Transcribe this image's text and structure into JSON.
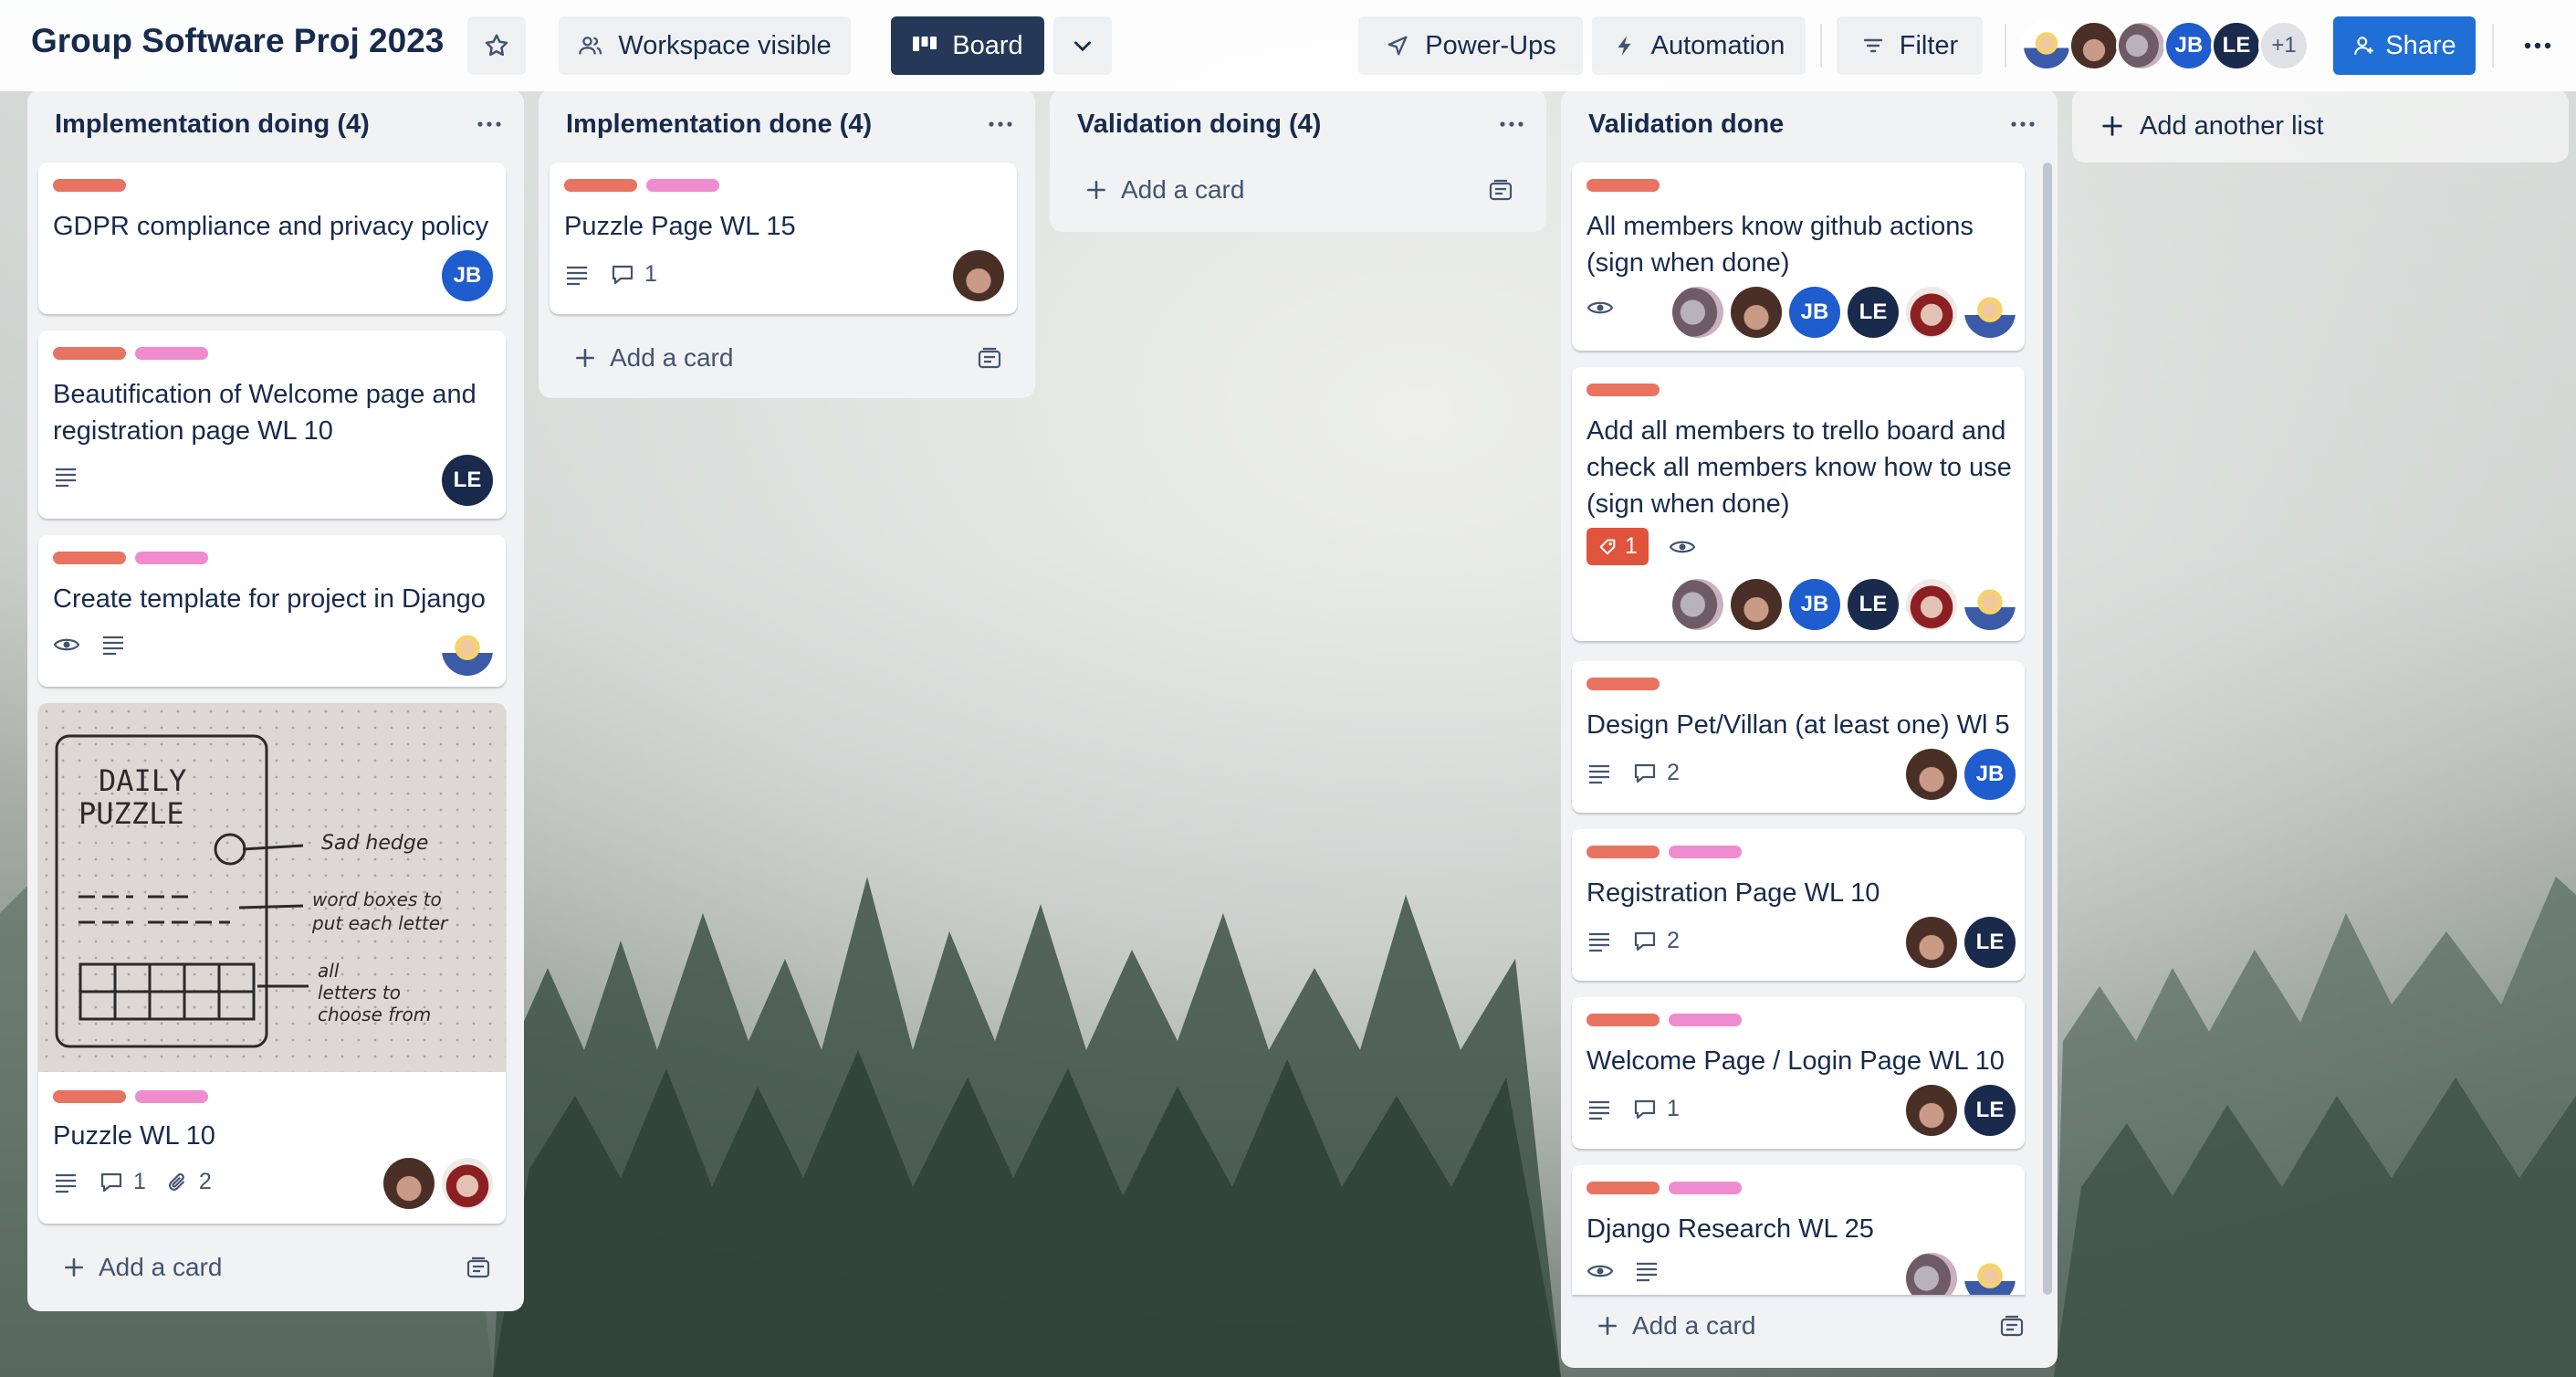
{
  "header": {
    "board_title": "Group Software Proj 2023",
    "visibility_label": "Workspace visible",
    "view_label": "Board",
    "powerups_label": "Power-Ups",
    "automation_label": "Automation",
    "filter_label": "Filter",
    "members_extra": "+1",
    "member_initials": [
      "JB",
      "LE"
    ],
    "share_label": "Share"
  },
  "lists": [
    {
      "title": "Implementation doing (4)",
      "add_card": "Add a card",
      "cards": [
        {
          "title": "GDPR compliance and privacy policy",
          "labels": [
            "red"
          ],
          "members": [
            "JB"
          ]
        },
        {
          "title": "Beautification of Welcome page and registration page WL 10",
          "labels": [
            "red",
            "pink"
          ],
          "members": [
            "LE"
          ]
        },
        {
          "title": "Create template for project in Django",
          "labels": [
            "red",
            "pink"
          ],
          "members": []
        },
        {
          "title": "Puzzle WL 10",
          "labels": [
            "red",
            "pink"
          ],
          "comments": "1",
          "attachments": "2",
          "members": []
        }
      ]
    },
    {
      "title": "Implementation done (4)",
      "add_card": "Add a card",
      "cards": [
        {
          "title": "Puzzle Page WL 15",
          "labels": [
            "red",
            "pink"
          ],
          "comments": "1",
          "members": []
        }
      ]
    },
    {
      "title": "Validation doing (4)",
      "add_card": "Add a card",
      "cards": []
    },
    {
      "title": "Validation done",
      "add_card": "Add a card",
      "cards": [
        {
          "title": "All members know github actions (sign when done)",
          "labels": [
            "red"
          ],
          "members": [
            "JB",
            "LE"
          ]
        },
        {
          "title": "Add all members to trello board and check all members know how to use (sign when done)",
          "labels": [
            "red"
          ],
          "flag_count": "1",
          "members": [
            "JB",
            "LE"
          ]
        },
        {
          "title": "Design Pet/Villan (at least one) Wl 5",
          "labels": [
            "red"
          ],
          "comments": "2",
          "members": [
            "JB"
          ]
        },
        {
          "title": "Registration Page WL 10",
          "labels": [
            "red",
            "pink"
          ],
          "comments": "2",
          "members": [
            "LE"
          ]
        },
        {
          "title": "Welcome Page / Login Page WL 10",
          "labels": [
            "red",
            "pink"
          ],
          "comments": "1",
          "members": [
            "LE"
          ]
        },
        {
          "title": "Django Research WL 25",
          "labels": [
            "red",
            "pink"
          ],
          "members": []
        }
      ]
    }
  ],
  "add_list_label": "Add another list",
  "colors": {
    "label_red": "#e87361",
    "label_pink": "#ef8bcf",
    "share_blue": "#1f6fd6",
    "board_btn": "#253858"
  },
  "icons": [
    "star-icon",
    "workspace-icon",
    "board-icon",
    "chevron-down-icon",
    "rocket-icon",
    "lightning-icon",
    "filter-icon",
    "share-person-icon",
    "more-icon",
    "description-icon",
    "comment-icon",
    "watch-icon",
    "attachment-icon",
    "plus-icon",
    "template-icon",
    "flag-icon"
  ]
}
